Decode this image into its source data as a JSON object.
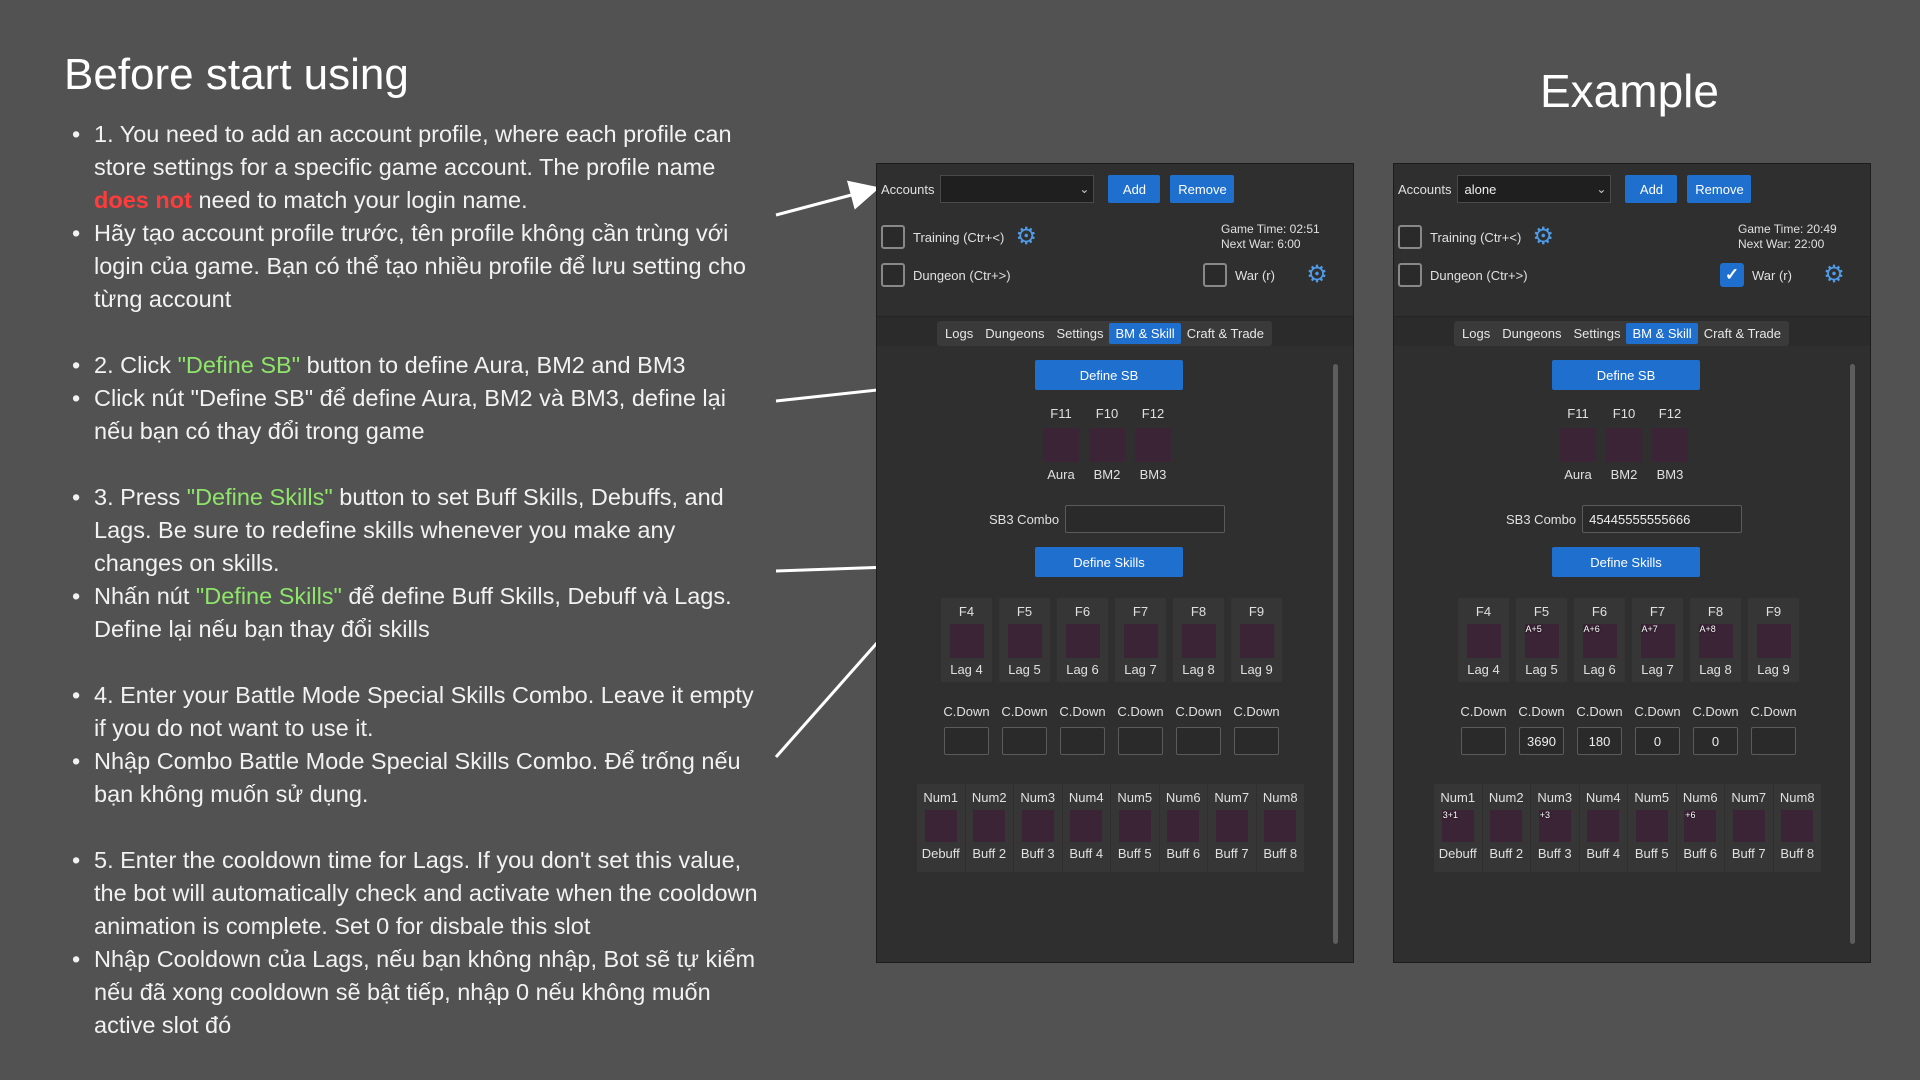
{
  "guide": {
    "title": "Before start using",
    "example_title": "Example",
    "step1_en_a": "1. You need to add an account profile, where each profile can store settings for a specific game account. The profile name ",
    "step1_en_red": "does not",
    "step1_en_b": " need to match your login name.",
    "step1_vi": "Hãy tạo account profile trước, tên profile không cần trùng với login của game. Bạn có thể tạo nhiều profile để lưu setting cho từng account",
    "step2_en_a": "2. Click ",
    "step2_en_green": "\"Define SB\"",
    "step2_en_b": " button to define Aura, BM2 and BM3",
    "step2_vi": "Click nút  \"Define SB\" để define Aura, BM2 và BM3, define lại nếu bạn có thay đổi trong game",
    "step3_en_a": "3. Press ",
    "step3_en_green": "\"Define Skills\"",
    "step3_en_b": " button to set Buff Skills, Debuffs, and Lags. Be sure to redefine skills whenever you make any changes on skills.",
    "step3_vi_a": "Nhấn nút ",
    "step3_vi_green": "\"Define Skills\"",
    "step3_vi_b": " để define Buff Skills, Debuff và Lags. Define lại nếu bạn thay đổi skills",
    "step4_en": "4. Enter your Battle Mode Special Skills Combo. Leave it empty if you do not want to use it.",
    "step4_vi": "Nhập Combo Battle Mode Special Skills Combo. Để trống nếu bạn không muốn sử dụng.",
    "step5_en": "5. Enter the cooldown time for Lags. If you don't set this value, the bot will automatically check and activate when the cooldown animation is complete. Set 0 for disbale this slot",
    "step5_vi": "Nhập Cooldown của Lags, nếu bạn không nhập, Bot sẽ tự kiểm nếu đã xong cooldown sẽ bật tiếp, nhập 0 nếu không muốn active slot đó"
  },
  "colors": {
    "accent": "#1f6fcf",
    "highlight_red": "#ff3b3b",
    "highlight_green": "#8ee56a",
    "background": "#525252",
    "panel": "#2f2f2f"
  },
  "ui": {
    "accounts_label": "Accounts",
    "add": "Add",
    "remove": "Remove",
    "training": "Training (Ctr+<)",
    "dungeon": "Dungeon (Ctr+>)",
    "war": "War (r)",
    "tabs": [
      "Logs",
      "Dungeons",
      "Settings",
      "BM & Skill",
      "Craft & Trade"
    ],
    "define_sb": "Define SB",
    "define_skills": "Define Skills",
    "sb3_label": "SB3 Combo",
    "sb_keys": [
      "F11",
      "F10",
      "F12"
    ],
    "sb_labels": [
      "Aura",
      "BM2",
      "BM3"
    ],
    "lag_keys": [
      "F4",
      "F5",
      "F6",
      "F7",
      "F8",
      "F9"
    ],
    "lag_labels": [
      "Lag 4",
      "Lag 5",
      "Lag 6",
      "Lag 7",
      "Lag 8",
      "Lag 9"
    ],
    "cd_label": "C.Down",
    "num_keys": [
      "Num1",
      "Num2",
      "Num3",
      "Num4",
      "Num5",
      "Num6",
      "Num7",
      "Num8"
    ],
    "num_labels": [
      "Debuff",
      "Buff 2",
      "Buff 3",
      "Buff 4",
      "Buff 5",
      "Buff 6",
      "Buff 7",
      "Buff 8"
    ]
  },
  "panel_left": {
    "account": "",
    "game_time": "Game Time: 02:51",
    "next_war": "Next War: 6:00",
    "training_checked": false,
    "dungeon_checked": false,
    "war_checked": false,
    "sb3_combo": "",
    "cooldowns": [
      "",
      "",
      "",
      "",
      "",
      ""
    ]
  },
  "panel_right": {
    "account": "alone",
    "game_time": "Game Time: 20:49",
    "next_war": "Next War: 22:00",
    "training_checked": false,
    "dungeon_checked": false,
    "war_checked": true,
    "sb3_combo": "45445555555666",
    "cooldowns": [
      "",
      "3690",
      "180",
      "0",
      "0",
      ""
    ],
    "sb_icons": [
      "aura-skill-icon",
      "bm2-skill-icon",
      "bm3-skill-icon"
    ],
    "lag_icons": [
      "",
      "lag5-skill-icon",
      "lag6-skill-icon",
      "lag7-skill-icon",
      "lag8-skill-icon",
      ""
    ],
    "lag_overlays": [
      "",
      "A+5",
      "A+6",
      "A+7",
      "A+8",
      ""
    ],
    "num_icons": [
      "debuff-skill-icon",
      "",
      "buff3-skill-icon",
      "buff4-skill-icon",
      "buff5-skill-icon",
      "buff6-skill-icon",
      "buff7-skill-icon",
      ""
    ],
    "num_overlays": [
      "3+1",
      "",
      "+3",
      "",
      "",
      "+6",
      "",
      ""
    ]
  }
}
